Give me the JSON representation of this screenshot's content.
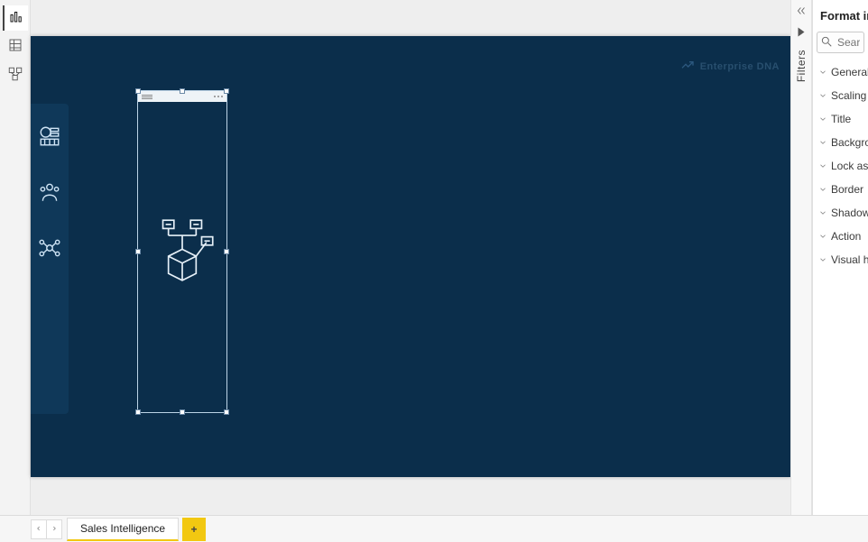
{
  "view_switcher": {
    "items": [
      {
        "name": "report-view-icon"
      },
      {
        "name": "data-view-icon"
      },
      {
        "name": "model-view-icon"
      }
    ],
    "active_index": 0
  },
  "canvas": {
    "brand_text": "Enterprise DNA"
  },
  "report_nav": {
    "icons": [
      {
        "name": "sales-summary-icon"
      },
      {
        "name": "customer-icon"
      },
      {
        "name": "product-icon"
      }
    ]
  },
  "selected_visual": {
    "type": "image",
    "header_visible": true
  },
  "filters_rail": {
    "label": "Filters"
  },
  "format_pane": {
    "title": "Format image",
    "search_placeholder": "Search",
    "sections": [
      "General",
      "Scaling",
      "Title",
      "Backgro...",
      "Lock asp...",
      "Border",
      "Shadow",
      "Action",
      "Visual he..."
    ]
  },
  "page_bar": {
    "active_tab": "Sales Intelligence",
    "add_label": "+"
  }
}
